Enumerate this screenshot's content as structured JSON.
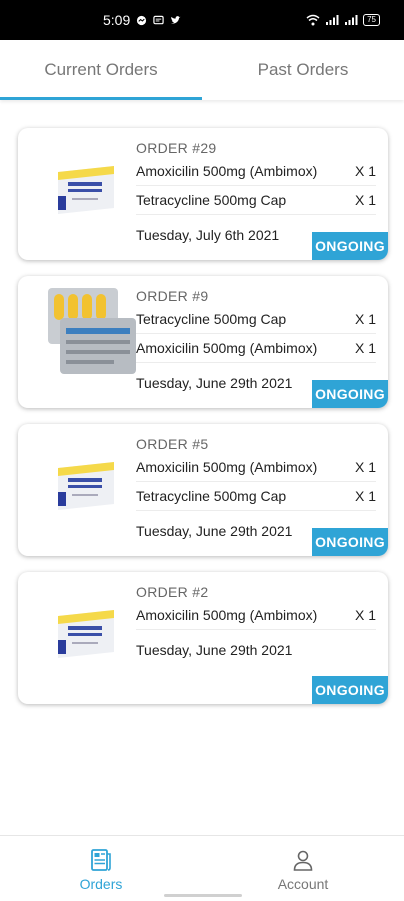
{
  "status_bar": {
    "time": "5:09",
    "battery": "75"
  },
  "tabs": [
    {
      "label": "Current Orders",
      "active": true
    },
    {
      "label": "Past Orders",
      "active": false
    }
  ],
  "orders": [
    {
      "order_no": "ORDER #29",
      "image": "amoxicillin-box",
      "items": [
        {
          "name": "Amoxicilin 500mg (Ambimox)",
          "qty": "X 1"
        },
        {
          "name": "Tetracycline 500mg Cap",
          "qty": "X 1"
        }
      ],
      "date": "Tuesday, July 6th 2021",
      "status": "ONGOING"
    },
    {
      "order_no": "ORDER #9",
      "image": "tetracycline-capsules",
      "items": [
        {
          "name": "Tetracycline 500mg Cap",
          "qty": "X 1"
        },
        {
          "name": "Amoxicilin 500mg (Ambimox)",
          "qty": "X 1"
        }
      ],
      "date": "Tuesday, June 29th 2021",
      "status": "ONGOING"
    },
    {
      "order_no": "ORDER #5",
      "image": "amoxicillin-box",
      "items": [
        {
          "name": "Amoxicilin 500mg (Ambimox)",
          "qty": "X 1"
        },
        {
          "name": "Tetracycline 500mg Cap",
          "qty": "X 1"
        }
      ],
      "date": "Tuesday, June 29th 2021",
      "status": "ONGOING"
    },
    {
      "order_no": "ORDER #2",
      "image": "amoxicillin-box",
      "items": [
        {
          "name": "Amoxicilin 500mg (Ambimox)",
          "qty": "X 1"
        }
      ],
      "date": "Tuesday, June 29th 2021",
      "status": "ONGOING"
    }
  ],
  "bottom_nav": [
    {
      "label": "Orders",
      "icon": "orders-icon",
      "active": true
    },
    {
      "label": "Account",
      "icon": "account-icon",
      "active": false
    }
  ],
  "colors": {
    "accent": "#2fa4d6",
    "status_bar": "#000000"
  }
}
